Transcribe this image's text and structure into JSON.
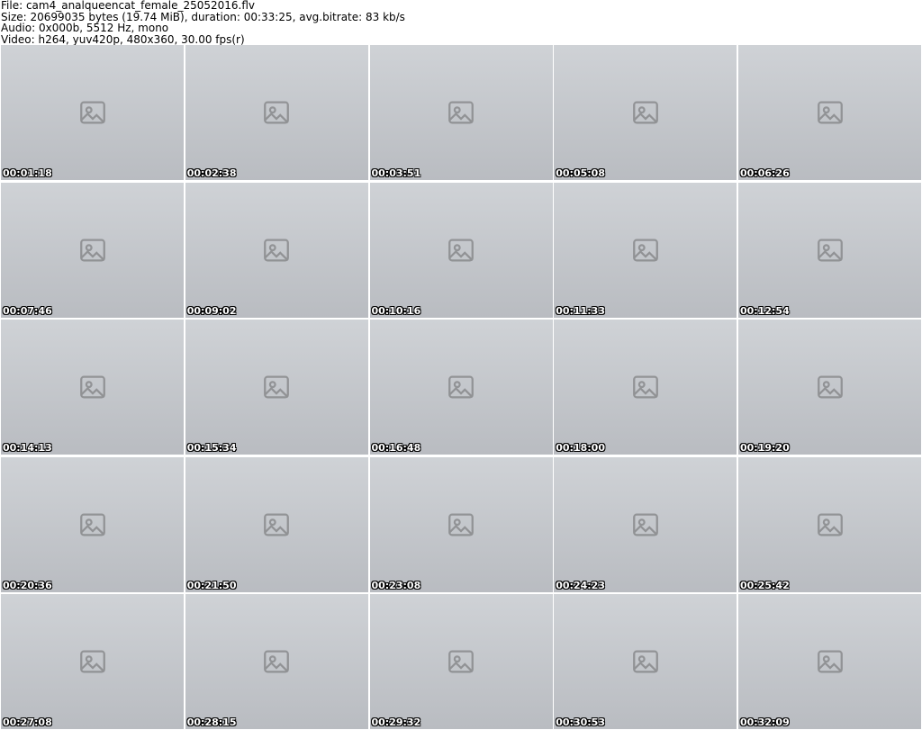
{
  "header": {
    "file": "File: cam4_analqueencat_female_25052016.flv",
    "size": "Size: 20699035 bytes (19.74 MiB), duration: 00:33:25, avg.bitrate: 83 kb/s",
    "audio": "Audio: 0x000b, 5512 Hz, mono",
    "video": "Video: h264, yuv420p, 480x360, 30.00 fps(r)"
  },
  "thumbnails": [
    {
      "timestamp": "00:01:18"
    },
    {
      "timestamp": "00:02:38"
    },
    {
      "timestamp": "00:03:51"
    },
    {
      "timestamp": "00:05:08"
    },
    {
      "timestamp": "00:06:26"
    },
    {
      "timestamp": "00:07:46"
    },
    {
      "timestamp": "00:09:02"
    },
    {
      "timestamp": "00:10:16"
    },
    {
      "timestamp": "00:11:33"
    },
    {
      "timestamp": "00:12:54"
    },
    {
      "timestamp": "00:14:13"
    },
    {
      "timestamp": "00:15:34"
    },
    {
      "timestamp": "00:16:48"
    },
    {
      "timestamp": "00:18:00"
    },
    {
      "timestamp": "00:19:20"
    },
    {
      "timestamp": "00:20:36"
    },
    {
      "timestamp": "00:21:50"
    },
    {
      "timestamp": "00:23:08"
    },
    {
      "timestamp": "00:24:23"
    },
    {
      "timestamp": "00:25:42"
    },
    {
      "timestamp": "00:27:08"
    },
    {
      "timestamp": "00:28:15"
    },
    {
      "timestamp": "00:29:32"
    },
    {
      "timestamp": "00:30:53"
    },
    {
      "timestamp": "00:32:09"
    }
  ],
  "icons": {
    "thumbnail_placeholder": "image-placeholder-icon"
  }
}
